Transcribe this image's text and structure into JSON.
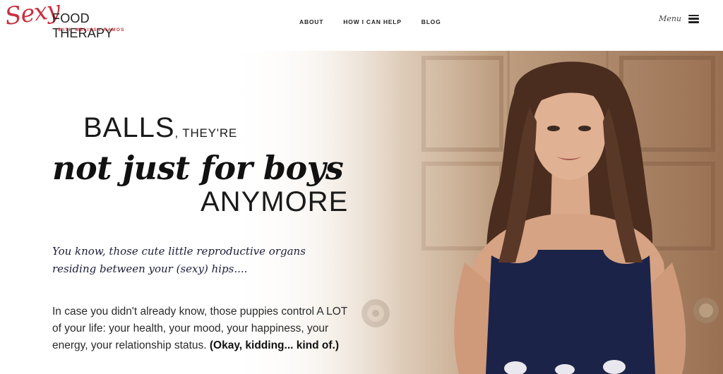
{
  "brand": {
    "script": "Sexy",
    "main": "FOOD THERAPY",
    "sub": "WITH MELISSA RAMOS"
  },
  "nav": {
    "items": [
      {
        "label": "ABOUT"
      },
      {
        "label": "HOW I CAN HELP"
      },
      {
        "label": "BLOG"
      }
    ],
    "menu_label": "Menu"
  },
  "hero": {
    "headline_1": "BALLS",
    "headline_1_small": ", THEY'RE",
    "headline_2": "not just for boys",
    "headline_3": "ANYMORE",
    "subhead_line_1": "You know, those cute little reproductive organs",
    "subhead_line_2": "residing between your (sexy) hips....",
    "body_text": "In case you didn't already know, those puppies control A LOT of your life: your health, your mood, your happiness, your energy, your relationship status. ",
    "body_bold": "(Okay, kidding... kind of.)"
  },
  "colors": {
    "brand_red": "#c7323f",
    "text_dark": "#1a1a1a",
    "dress_navy": "#1c2348"
  }
}
